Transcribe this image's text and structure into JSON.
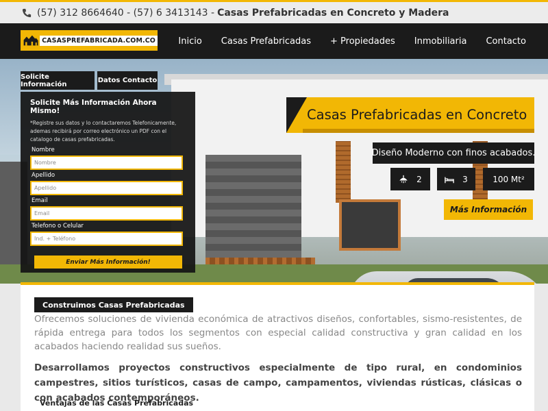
{
  "topbar": {
    "phones": "(57) 312 8664640 - (57) 6 3413143 -",
    "tagline": "Casas Prefabricadas en Concreto y Madera"
  },
  "logo": {
    "text": "CASASPREFABRICADA.COM.CO"
  },
  "nav": {
    "items": [
      "Inicio",
      "Casas Prefabricadas",
      "+ Propiedades",
      "Inmobiliaria",
      "Contacto"
    ]
  },
  "tabs": {
    "info": "Solicite Información",
    "contact": "Datos Contacto"
  },
  "form": {
    "title": "Solicite Más Información Ahora Mismo!",
    "description": "*Registre sus datos y lo contactaremos Telefonicamente, ademas recibirá por correo electrónico un PDF con el catalogo de casas prefabricadas.",
    "fields": [
      {
        "label": "Nombre",
        "placeholder": "Nombre"
      },
      {
        "label": "Apellido",
        "placeholder": "Apellido"
      },
      {
        "label": "Email",
        "placeholder": "Email"
      },
      {
        "label": "Telefono o Celular",
        "placeholder": "Ind. + Teléfono"
      }
    ],
    "submit": "Enviar Más Información!"
  },
  "banner": {
    "title": "Casas Prefabricadas en Concreto",
    "subtitle": "Diseño Moderno con finos acabados.",
    "features": {
      "baths": "2",
      "beds": "3",
      "area": "100  Mt²"
    },
    "more_button": "Más Información"
  },
  "content": {
    "section_label": "Construimos Casas Prefabricadas",
    "intro": "Ofrecemos soluciones de vivienda económica de atractivos diseños, confortables, sismo-resistentes, de rápida entrega para todos los segmentos con especial calidad constructiva y gran calidad en los acabados haciendo realidad sus sueños.",
    "bold_paragraph": "Desarrollamos proyectos constructivos especialmente de tipo rural, en condominios campestres, sitios turísticos, casas de campo, campamentos, viviendas rústicas, clásicas o con acabados contemporáneos.",
    "section2": "Ventajas de las Casas Prefabricadas"
  },
  "colors": {
    "accent": "#f2b705",
    "dark": "#1b1b1b"
  }
}
